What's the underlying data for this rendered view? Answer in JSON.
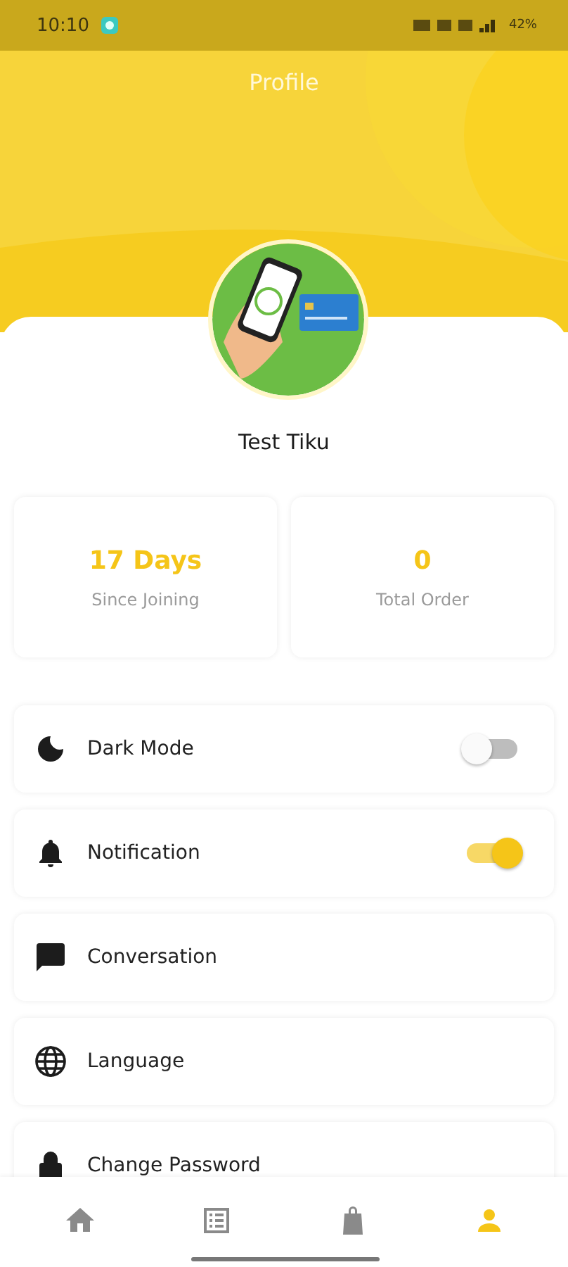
{
  "status_bar": {
    "time": "10:10",
    "battery": "42%"
  },
  "header": {
    "title": "Profile"
  },
  "profile": {
    "name": "Test Tiku"
  },
  "stats": [
    {
      "value": "17 Days",
      "label": "Since Joining"
    },
    {
      "value": "0",
      "label": "Total Order"
    }
  ],
  "settings": [
    {
      "kind": "toggle",
      "label": "Dark Mode",
      "on": false
    },
    {
      "kind": "toggle",
      "label": "Notification",
      "on": true
    },
    {
      "kind": "link",
      "label": "Conversation"
    },
    {
      "kind": "link",
      "label": "Language"
    },
    {
      "kind": "link",
      "label": "Change Password"
    }
  ],
  "bottom_nav": [
    {
      "selected": false
    },
    {
      "selected": false
    },
    {
      "selected": false
    },
    {
      "selected": true
    }
  ]
}
